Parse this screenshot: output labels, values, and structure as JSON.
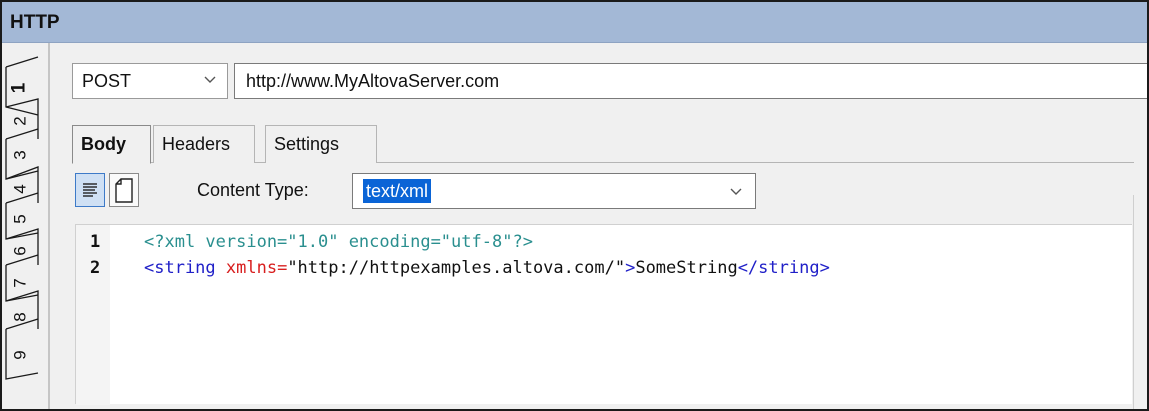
{
  "window": {
    "title": "HTTP"
  },
  "vertical_tabs": [
    "1",
    "2",
    "3",
    "4",
    "5",
    "6",
    "7",
    "8",
    "9"
  ],
  "request": {
    "method": "POST",
    "url": "http://www.MyAltovaServer.com"
  },
  "tabs": [
    {
      "label": "Body",
      "active": true
    },
    {
      "label": "Headers",
      "active": false
    },
    {
      "label": "Settings",
      "active": false
    }
  ],
  "body_toolbar": {
    "content_type_label": "Content Type:",
    "content_type_value": "text/xml",
    "buttons": [
      "text-view-icon",
      "document-view-icon"
    ]
  },
  "editor": {
    "lines": [
      {
        "number": "1",
        "pi": "<?xml version=\"1.0\" encoding=\"utf-8\"?>"
      },
      {
        "number": "2",
        "open_tag": "<string",
        "attr_name": " xmlns=",
        "attr_value": "\"http://httpexamples.altova.com/\"",
        "open_close": ">",
        "text": "SomeString",
        "close_tag": "</string>"
      }
    ]
  },
  "colors": {
    "titlebar": "#a3b8d6",
    "selection": "#0a64d6",
    "xml_pi": "#2a8f8f",
    "xml_tag": "#2020c8",
    "xml_attr": "#d81e1e"
  }
}
